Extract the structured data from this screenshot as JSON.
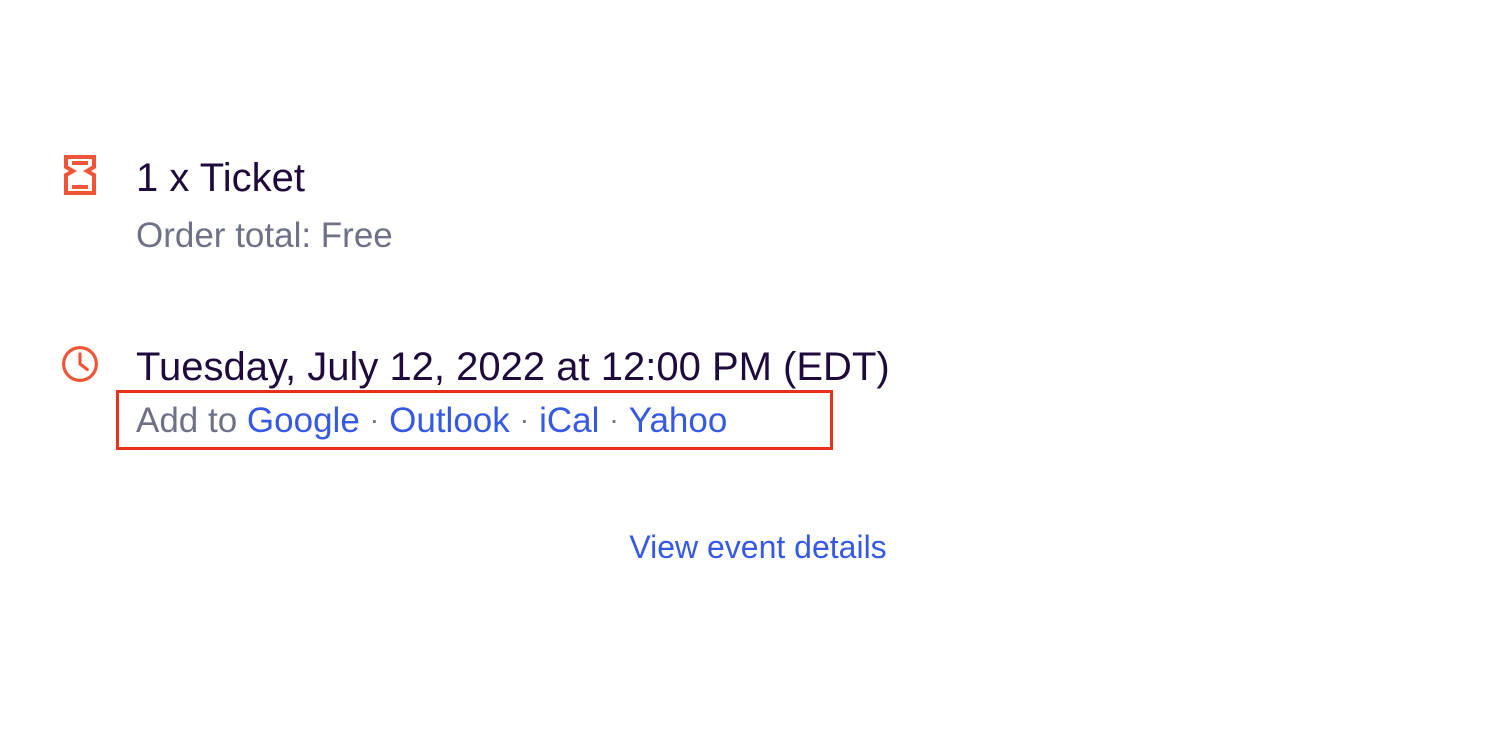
{
  "colors": {
    "accent_orange": "#f05537",
    "link_blue": "#3659e3",
    "primary_text": "#1e0a3c",
    "secondary_text": "#6f7287",
    "highlight_red": "#e8301c"
  },
  "ticket": {
    "icon": "ticket-icon",
    "title": "1 x Ticket",
    "order_total": "Order total: Free"
  },
  "event_time": {
    "icon": "clock-icon",
    "datetime": "Tuesday, July 12, 2022 at 12:00 PM (EDT)",
    "add_to_label": "Add to ",
    "separator": "·",
    "calendars": [
      "Google",
      "Outlook",
      "iCal",
      "Yahoo"
    ]
  },
  "footer": {
    "view_details": "View event details"
  }
}
